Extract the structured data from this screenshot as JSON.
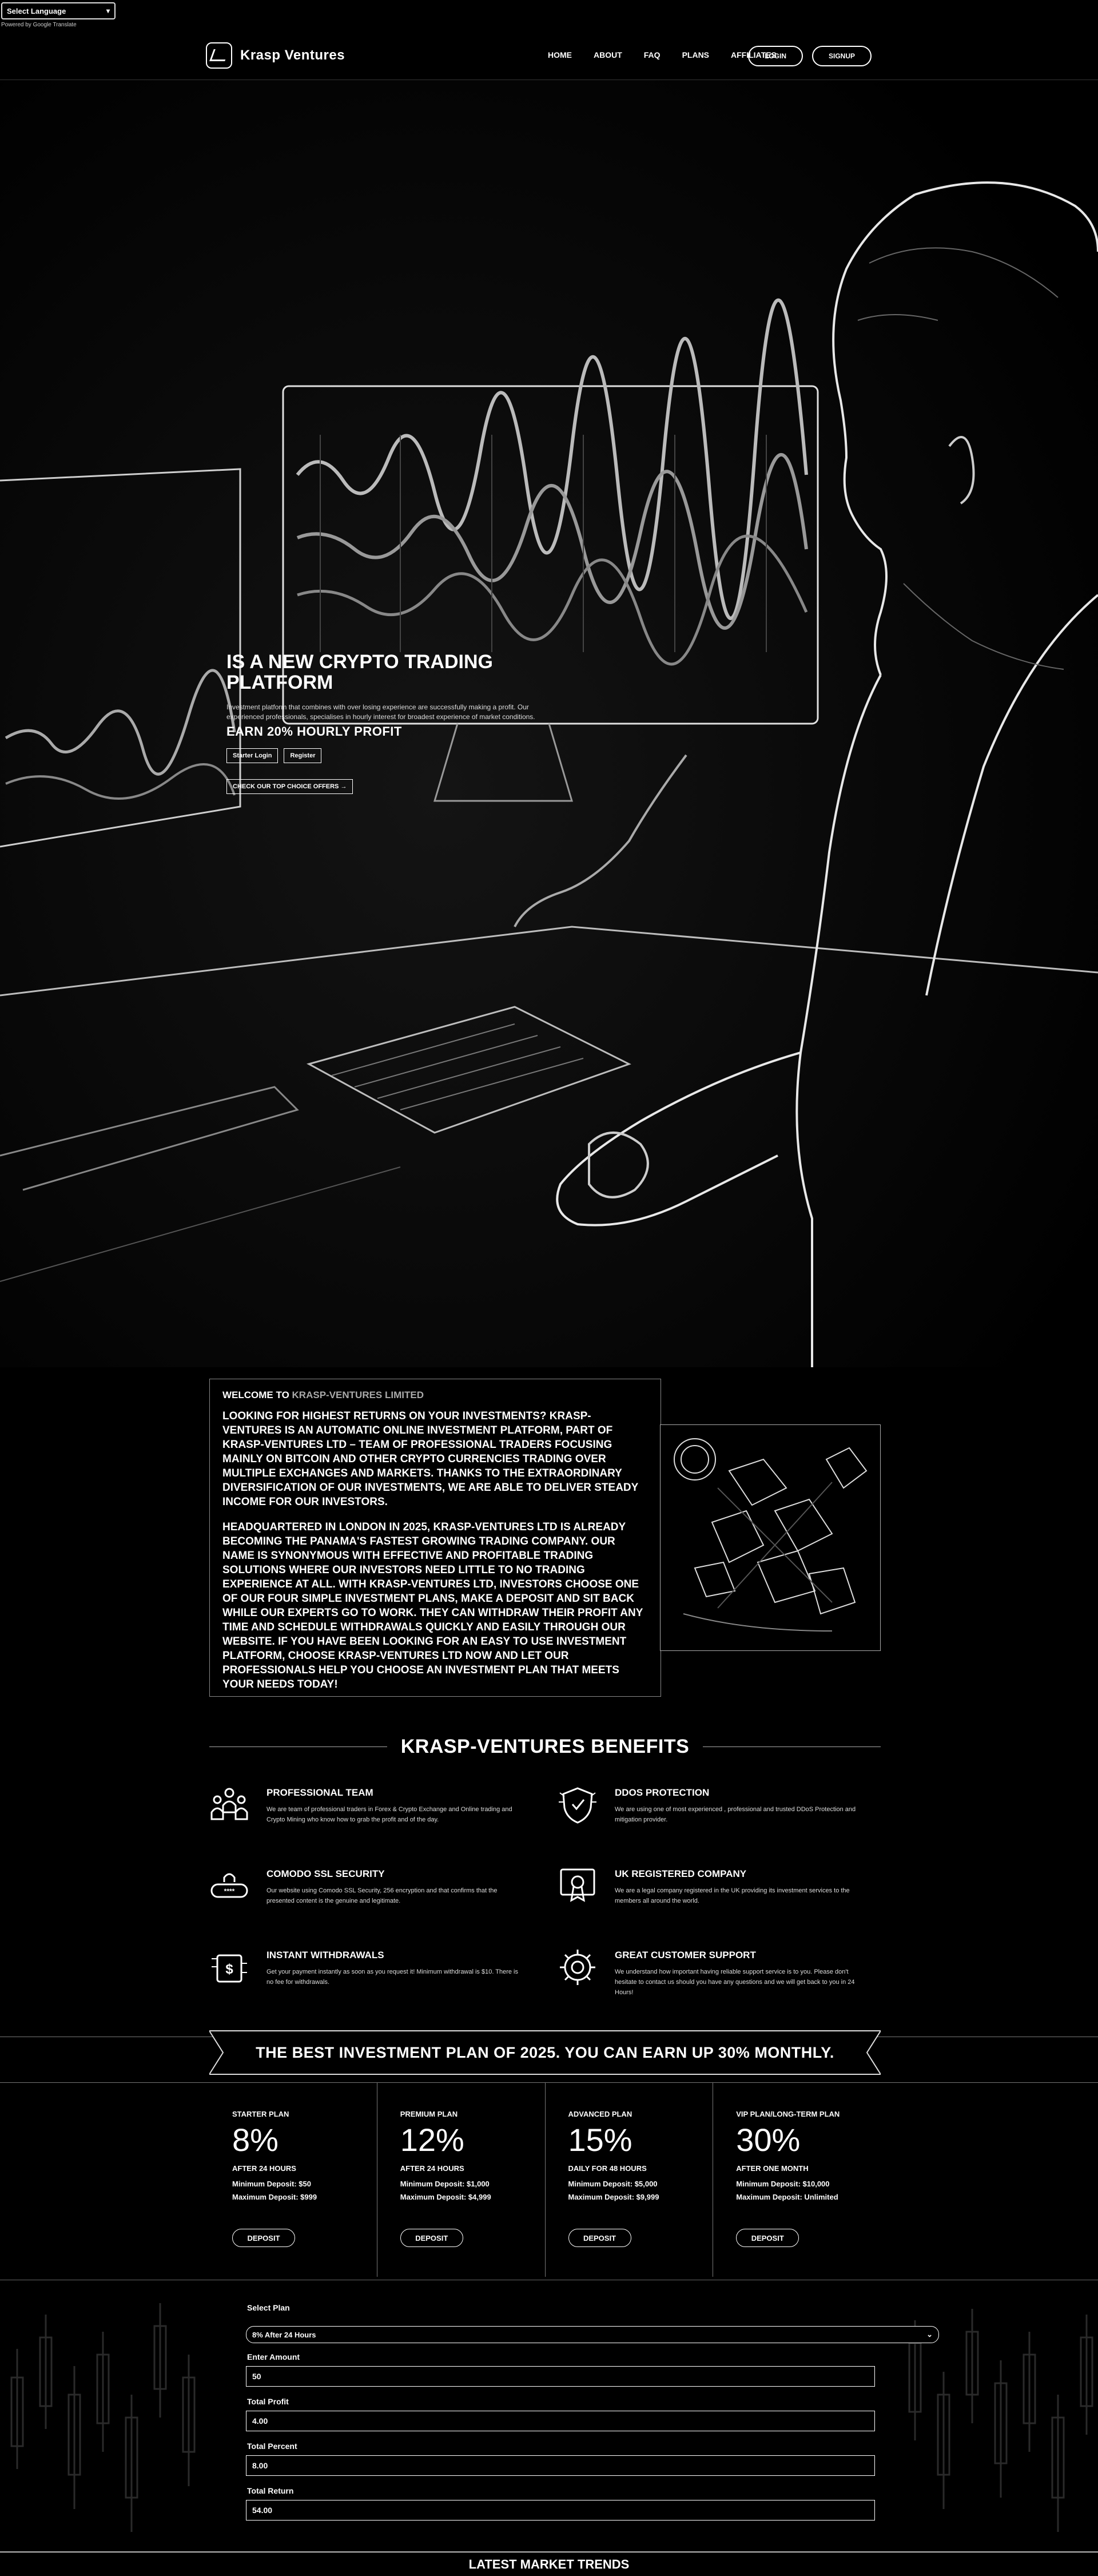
{
  "translate": {
    "select_label": "Select Language",
    "powered_by": "Powered by Google Translate"
  },
  "header": {
    "brand": "Krasp Ventures",
    "nav": [
      "HOME",
      "ABOUT",
      "FAQ",
      "PLANS",
      "AFFILIATES"
    ],
    "login": "LOGIN",
    "signup": "SIGNUP"
  },
  "hero": {
    "title": "IS A NEW CRYPTO TRADING PLATFORM",
    "subtitle": "Investment platform that combines with over losing experience are successfully making a profit. Our experienced professionals, specialises in hourly interest for broadest experience of market conditions.",
    "earn": "EARN 20% HOURLY PROFIT",
    "btn_start": "Starter Login",
    "btn_register": "Register",
    "link_offer": "CHECK OUR TOP CHOICE OFFERS →"
  },
  "welcome": {
    "heading_prefix": "WELCOME TO",
    "heading_brand": "KRASP-VENTURES LIMITED",
    "para1": "LOOKING FOR HIGHEST RETURNS ON YOUR INVESTMENTS? KRASP-VENTURES IS AN AUTOMATIC ONLINE INVESTMENT PLATFORM, PART OF KRASP-VENTURES LTD – TEAM OF PROFESSIONAL TRADERS FOCUSING MAINLY ON BITCOIN AND OTHER CRYPTO CURRENCIES TRADING OVER MULTIPLE EXCHANGES AND MARKETS. THANKS TO THE EXTRAORDINARY DIVERSIFICATION OF OUR INVESTMENTS, WE ARE ABLE TO DELIVER STEADY INCOME FOR OUR INVESTORS.",
    "para2": "HEADQUARTERED IN LONDON IN 2025, KRASP-VENTURES LTD IS ALREADY BECOMING THE PANAMA'S FASTEST GROWING TRADING COMPANY. OUR NAME IS SYNONYMOUS WITH EFFECTIVE AND PROFITABLE TRADING SOLUTIONS WHERE OUR INVESTORS NEED LITTLE TO NO TRADING EXPERIENCE AT ALL. WITH KRASP-VENTURES LTD, INVESTORS CHOOSE ONE OF OUR FOUR SIMPLE INVESTMENT PLANS, MAKE A DEPOSIT AND SIT BACK WHILE OUR EXPERTS GO TO WORK. THEY CAN WITHDRAW THEIR PROFIT ANY TIME AND SCHEDULE WITHDRAWALS QUICKLY AND EASILY THROUGH OUR WEBSITE. IF YOU HAVE BEEN LOOKING FOR AN EASY TO USE INVESTMENT PLATFORM, CHOOSE KRASP-VENTURES LTD NOW AND LET OUR PROFESSIONALS HELP YOU CHOOSE AN INVESTMENT PLAN THAT MEETS YOUR NEEDS TODAY!"
  },
  "benefits": {
    "title": "KRASP-VENTURES BENEFITS",
    "items": [
      {
        "title": "PROFESSIONAL TEAM",
        "desc": "We are team of professional traders in Forex & Crypto Exchange and Online trading and Crypto Mining who know how to grab the profit and of the day.",
        "icon": "team-icon"
      },
      {
        "title": "DDOS PROTECTION",
        "desc": "We are using one of most experienced , professional and trusted DDoS Protection and mitigation provider.",
        "icon": "shield-icon"
      },
      {
        "title": "COMODO SSL SECURITY",
        "desc": "Our website using Comodo SSL Security, 256 encryption and that confirms that the presented content is the genuine and legitimate.",
        "icon": "lock-icon"
      },
      {
        "title": "UK REGISTERED COMPANY",
        "desc": "We are a legal company registered in the UK providing its investment services to the members all around the world.",
        "icon": "certificate-icon"
      },
      {
        "title": "INSTANT WITHDRAWALS",
        "desc": "Get your payment instantly as soon as you request it! Minimum withdrawal is $10. There is no fee for withdrawals.",
        "icon": "money-icon"
      },
      {
        "title": "GREAT CUSTOMER SUPPORT",
        "desc": "We understand how important having reliable support service is to you. Please don't hesitate to contact us should you have any questions and we will get back to you in 24 Hours!",
        "icon": "support-icon"
      }
    ]
  },
  "banner": {
    "text": "THE BEST INVESTMENT PLAN OF 2025. YOU CAN EARN UP 30% MONTHLY."
  },
  "plans": [
    {
      "name": "STARTER PLAN",
      "pct": "8%",
      "period": "AFTER 24 HOURS",
      "min": "Minimum Deposit: $50",
      "max": "Maximum Deposit: $999",
      "btn": "DEPOSIT"
    },
    {
      "name": "PREMIUM PLAN",
      "pct": "12%",
      "period": "AFTER 24 HOURS",
      "min": "Minimum Deposit: $1,000",
      "max": "Maximum Deposit: $4,999",
      "btn": "DEPOSIT"
    },
    {
      "name": "ADVANCED PLAN",
      "pct": "15%",
      "period": "DAILY FOR 48 HOURS",
      "min": "Minimum Deposit: $5,000",
      "max": "Maximum Deposit: $9,999",
      "btn": "DEPOSIT"
    },
    {
      "name": "VIP PLAN/LONG-TERM PLAN",
      "pct": "30%",
      "period": "AFTER ONE MONTH",
      "min": "Minimum Deposit: $10,000",
      "max": "Maximum Deposit: Unlimited",
      "btn": "DEPOSIT"
    }
  ],
  "calculator": {
    "select_label": "Select Plan",
    "select_value": "8% After 24 Hours",
    "amount_label": "Enter Amount",
    "amount_value": "50",
    "profit_label": "Total Profit",
    "profit_value": "4.00",
    "percent_label": "Total Percent",
    "percent_value": "8.00",
    "return_label": "Total Return",
    "return_value": "54.00"
  },
  "trends": {
    "title": "LATEST MARKET TRENDS"
  }
}
